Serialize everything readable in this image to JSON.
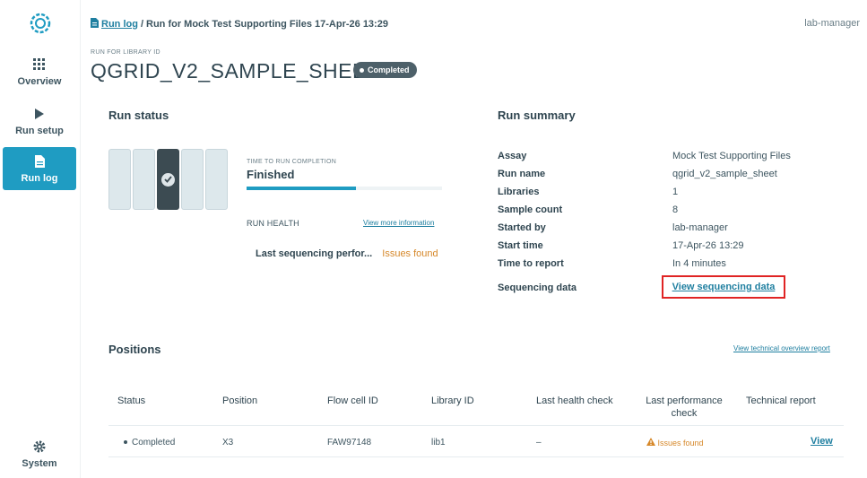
{
  "app": {
    "accent": "#1f9cc2"
  },
  "sidebar": {
    "items": [
      {
        "label": "Overview",
        "icon": "grid-icon"
      },
      {
        "label": "Run setup",
        "icon": "play-icon"
      },
      {
        "label": "Run log",
        "icon": "document-icon",
        "active": true
      },
      {
        "label": "System",
        "icon": "gear-icon"
      }
    ]
  },
  "header": {
    "breadcrumb_link": "Run log",
    "breadcrumb_sep": "/",
    "breadcrumb_current": "Run for Mock Test Supporting Files 17-Apr-26 13:29",
    "user": "lab-manager",
    "run_for_label": "RUN FOR LIBRARY ID",
    "title": "QGRID_V2_SAMPLE_SHEET",
    "status_badge": "Completed"
  },
  "run_status": {
    "title": "Run status",
    "time_label": "TIME TO RUN COMPLETION",
    "state": "Finished",
    "progress_fraction": 0.56,
    "health_label": "RUN HEALTH",
    "view_more": "View more information",
    "check_name": "Last sequencing perfor...",
    "check_result": "Issues found"
  },
  "run_summary": {
    "title": "Run summary",
    "rows": [
      {
        "key": "Assay",
        "value": "Mock Test Supporting Files"
      },
      {
        "key": "Run name",
        "value": "qgrid_v2_sample_sheet"
      },
      {
        "key": "Libraries",
        "value": "1"
      },
      {
        "key": "Sample count",
        "value": "8"
      },
      {
        "key": "Started by",
        "value": "lab-manager"
      },
      {
        "key": "Start time",
        "value": "17-Apr-26 13:29"
      },
      {
        "key": "Time to report",
        "value": "In 4 minutes"
      }
    ],
    "seq_key": "Sequencing data",
    "seq_link": "View sequencing data"
  },
  "positions": {
    "title": "Positions",
    "tech_overview_link": "View technical overview report",
    "columns": [
      "Status",
      "Position",
      "Flow cell ID",
      "Library ID",
      "Last health check",
      "Last performance check",
      "Technical report"
    ],
    "rows": [
      {
        "status": "Completed",
        "position": "X3",
        "flow_cell_id": "FAW97148",
        "library_id": "lib1",
        "health": "–",
        "performance": "Issues found",
        "report": "View"
      }
    ]
  }
}
